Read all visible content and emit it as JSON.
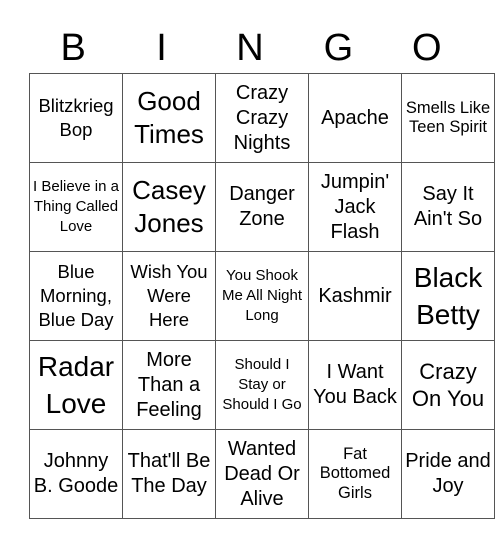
{
  "header": [
    "B",
    "I",
    "N",
    "G",
    "O"
  ],
  "rows": [
    [
      "Blitzkrieg Bop",
      "Good Times",
      "Crazy Crazy Nights",
      "Apache",
      "Smells Like Teen Spirit"
    ],
    [
      "I Believe in a Thing Called Love",
      "Casey Jones",
      "Danger Zone",
      "Jumpin' Jack Flash",
      "Say It Ain't So"
    ],
    [
      "Blue Morning, Blue Day",
      "Wish You Were Here",
      "You Shook Me All Night Long",
      "Kashmir",
      "Black Betty"
    ],
    [
      "Radar Love",
      "More Than a Feeling",
      "Should I Stay or Should I Go",
      "I Want You Back",
      "Crazy On You"
    ],
    [
      "Johnny B. Goode",
      "That'll Be The Day",
      "Wanted Dead Or Alive",
      "Fat Bottomed Girls",
      "Pride and Joy"
    ]
  ]
}
